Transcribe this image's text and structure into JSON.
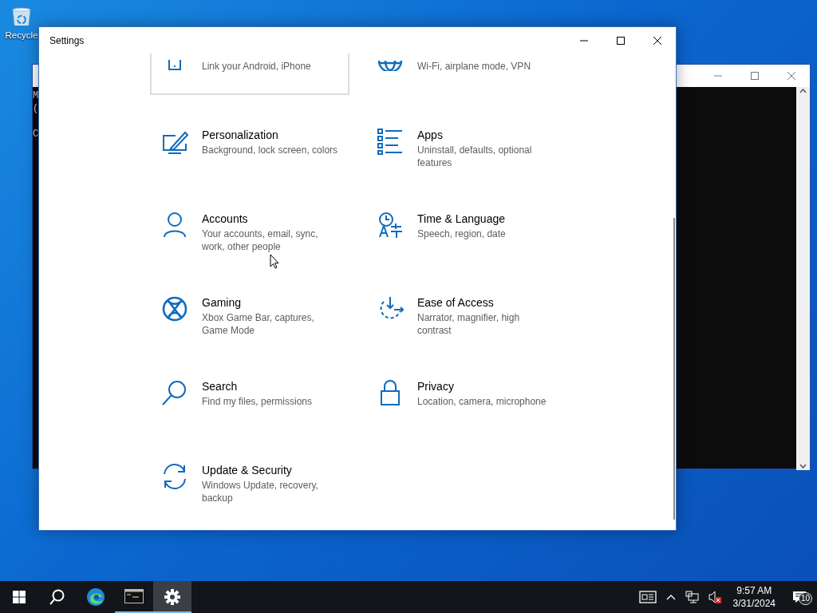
{
  "desktop": {
    "icons": [
      {
        "label": "Recycle"
      }
    ]
  },
  "console_window": {
    "lines": [
      "M",
      "(",
      "C"
    ]
  },
  "settings_window": {
    "title": "Settings",
    "tiles": [
      {
        "description": "Link your Android, iPhone",
        "hovered": true
      },
      {
        "description": "Wi-Fi, airplane mode, VPN",
        "hovered": false
      },
      {
        "title": "Personalization",
        "description": "Background, lock screen, colors",
        "hovered": false
      },
      {
        "title": "Apps",
        "description": "Uninstall, defaults, optional features",
        "hovered": false
      },
      {
        "title": "Accounts",
        "description": "Your accounts, email, sync, work, other people",
        "hovered": false
      },
      {
        "title": "Time & Language",
        "description": "Speech, region, date",
        "hovered": false
      },
      {
        "title": "Gaming",
        "description": "Xbox Game Bar, captures, Game Mode",
        "hovered": false
      },
      {
        "title": "Ease of Access",
        "description": "Narrator, magnifier, high contrast",
        "hovered": false
      },
      {
        "title": "Search",
        "description": "Find my files, permissions",
        "hovered": false
      },
      {
        "title": "Privacy",
        "description": "Location, camera, microphone",
        "hovered": false
      },
      {
        "title": "Update & Security",
        "description": "Windows Update, recovery, backup",
        "hovered": false
      }
    ]
  },
  "taskbar": {
    "apps": [
      {
        "running": false,
        "selected": false
      },
      {
        "running": false,
        "selected": false
      },
      {
        "running": false,
        "selected": false
      },
      {
        "running": true,
        "selected": false
      },
      {
        "running": true,
        "selected": true
      }
    ],
    "tray": {
      "time": "9:57 AM",
      "date": "3/31/2024",
      "notification_count": "10"
    }
  }
}
